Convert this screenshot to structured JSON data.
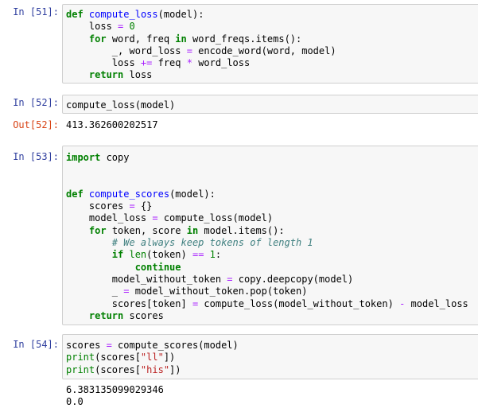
{
  "cells": [
    {
      "prompt": "In [51]:",
      "code": [
        [
          [
            "def",
            "kw"
          ],
          [
            " ",
            ""
          ],
          [
            "compute_loss",
            "fn"
          ],
          [
            "(model):",
            ""
          ]
        ],
        [
          [
            "    loss ",
            ""
          ],
          [
            "=",
            "op"
          ],
          [
            " ",
            ""
          ],
          [
            "0",
            "num"
          ]
        ],
        [
          [
            "    ",
            ""
          ],
          [
            "for",
            "kw"
          ],
          [
            " word, freq ",
            ""
          ],
          [
            "in",
            "kw"
          ],
          [
            " word_freqs.items():",
            ""
          ]
        ],
        [
          [
            "        _, word_loss ",
            ""
          ],
          [
            "=",
            "op"
          ],
          [
            " encode_word(word, model)",
            ""
          ]
        ],
        [
          [
            "        loss ",
            ""
          ],
          [
            "+=",
            "op"
          ],
          [
            " freq ",
            ""
          ],
          [
            "*",
            "op"
          ],
          [
            " word_loss",
            ""
          ]
        ],
        [
          [
            "    ",
            ""
          ],
          [
            "return",
            "kw"
          ],
          [
            " loss",
            ""
          ]
        ]
      ]
    },
    {
      "prompt": "In [52]:",
      "code": [
        [
          [
            "compute_loss(model)",
            ""
          ]
        ]
      ],
      "out_prompt": "Out[52]:",
      "output": [
        "413.362600202517"
      ]
    },
    {
      "prompt": "In [53]:",
      "code": [
        [
          [
            "import",
            "kw"
          ],
          [
            " copy",
            ""
          ]
        ],
        [
          [
            "",
            ""
          ]
        ],
        [
          [
            "",
            ""
          ]
        ],
        [
          [
            "def",
            "kw"
          ],
          [
            " ",
            ""
          ],
          [
            "compute_scores",
            "fn"
          ],
          [
            "(model):",
            ""
          ]
        ],
        [
          [
            "    scores ",
            ""
          ],
          [
            "=",
            "op"
          ],
          [
            " {}",
            ""
          ]
        ],
        [
          [
            "    model_loss ",
            ""
          ],
          [
            "=",
            "op"
          ],
          [
            " compute_loss(model)",
            ""
          ]
        ],
        [
          [
            "    ",
            ""
          ],
          [
            "for",
            "kw"
          ],
          [
            " token, score ",
            ""
          ],
          [
            "in",
            "kw"
          ],
          [
            " model.items():",
            ""
          ]
        ],
        [
          [
            "        ",
            ""
          ],
          [
            "# We always keep tokens of length 1",
            "cm"
          ]
        ],
        [
          [
            "        ",
            ""
          ],
          [
            "if",
            "kw"
          ],
          [
            " ",
            ""
          ],
          [
            "len",
            "bi"
          ],
          [
            "(token) ",
            ""
          ],
          [
            "==",
            "op"
          ],
          [
            " ",
            ""
          ],
          [
            "1",
            "num"
          ],
          [
            ":",
            ""
          ]
        ],
        [
          [
            "            ",
            ""
          ],
          [
            "continue",
            "kw"
          ]
        ],
        [
          [
            "        model_without_token ",
            ""
          ],
          [
            "=",
            "op"
          ],
          [
            " copy.deepcopy(model)",
            ""
          ]
        ],
        [
          [
            "        _ ",
            ""
          ],
          [
            "=",
            "op"
          ],
          [
            " model_without_token.pop(token)",
            ""
          ]
        ],
        [
          [
            "        scores[token] ",
            ""
          ],
          [
            "=",
            "op"
          ],
          [
            " compute_loss(model_without_token) ",
            ""
          ],
          [
            "-",
            "op"
          ],
          [
            " model_loss",
            ""
          ]
        ],
        [
          [
            "    ",
            ""
          ],
          [
            "return",
            "kw"
          ],
          [
            " scores",
            ""
          ]
        ]
      ]
    },
    {
      "prompt": "In [54]:",
      "code": [
        [
          [
            "scores ",
            ""
          ],
          [
            "=",
            "op"
          ],
          [
            " compute_scores(model)",
            ""
          ]
        ],
        [
          [
            "print",
            "bi"
          ],
          [
            "(scores[",
            ""
          ],
          [
            "\"ll\"",
            "str"
          ],
          [
            "])",
            ""
          ]
        ],
        [
          [
            "print",
            "bi"
          ],
          [
            "(scores[",
            ""
          ],
          [
            "\"his\"",
            "str"
          ],
          [
            "])",
            ""
          ]
        ]
      ],
      "output": [
        "6.383135099029346",
        "0.0"
      ]
    }
  ]
}
